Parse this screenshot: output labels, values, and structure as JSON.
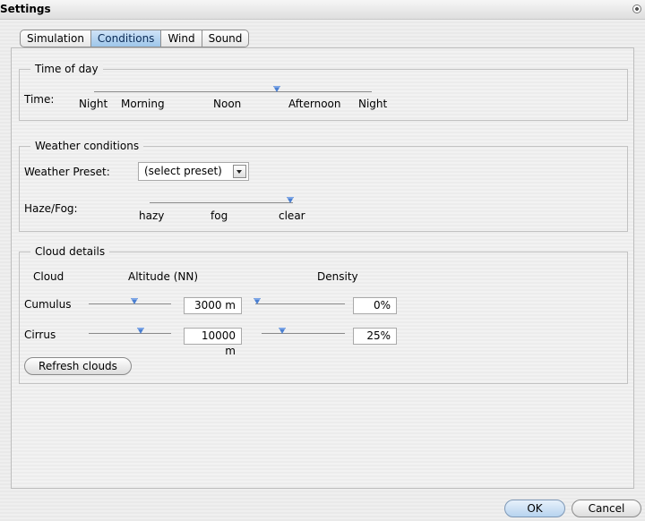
{
  "window": {
    "title": "Settings"
  },
  "tabs": [
    {
      "label": "Simulation",
      "active": false
    },
    {
      "label": "Conditions",
      "active": true
    },
    {
      "label": "Wind",
      "active": false
    },
    {
      "label": "Sound",
      "active": false
    }
  ],
  "time_of_day": {
    "legend": "Time of day",
    "label": "Time:",
    "ticks": [
      "Night",
      "Morning",
      "Noon",
      "Afternoon",
      "Night"
    ],
    "slider_fraction": 0.66
  },
  "weather": {
    "legend": "Weather conditions",
    "preset_label": "Weather Preset:",
    "preset_value": "(select preset)",
    "haze_label": "Haze/Fog:",
    "haze_ticks": [
      "hazy",
      "fog",
      "clear"
    ],
    "haze_fraction": 0.98
  },
  "cloud": {
    "legend": "Cloud details",
    "header_cloud": "Cloud",
    "header_altitude": "Altitude (NN)",
    "header_density": "Density",
    "rows": [
      {
        "name": "Cumulus",
        "altitude": "3000 m",
        "altitude_fraction": 0.55,
        "density": "0%",
        "density_fraction": 0.0
      },
      {
        "name": "Cirrus",
        "altitude": "10000 m",
        "altitude_fraction": 0.63,
        "density": "25%",
        "density_fraction": 0.25
      }
    ],
    "refresh_label": "Refresh clouds"
  },
  "footer": {
    "ok_label": "OK",
    "cancel_label": "Cancel"
  },
  "colors": {
    "accent": "#4a7fd1",
    "active_tab": "#9ec6ea"
  }
}
